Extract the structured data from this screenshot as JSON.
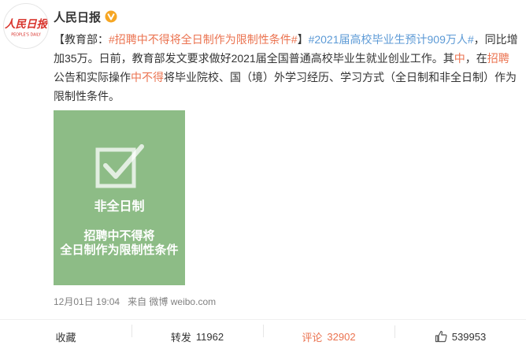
{
  "user": {
    "name": "人民日报",
    "avatar_logo_text": "人民日报",
    "avatar_sub_text": "PEOPLE'S DAILY"
  },
  "post": {
    "prefix": "【教育部：",
    "hashtag1": "#招聘中不得将全日制作为限制性条件#",
    "bracket_close": "】",
    "hashtag2": "#2021届高校毕业生预计909万人#",
    "p1": "，同比增加35万。日前，教育部发文要求做好2021届全国普通高校毕业生就业创业工作。其",
    "p1_hl": "中",
    "p2": "，在",
    "p2_hl": "招聘",
    "p3": "公告和实际操作",
    "p3_hl": "中不得",
    "p4": "将毕业院校、国（境）外学习经历、学习方式（全日制和非全日制）作为限制性条件。"
  },
  "image": {
    "tag": "非全日制",
    "line1": "招聘中不得将",
    "line2": "全日制作为限制性条件",
    "bg_color": "#8dbc86"
  },
  "meta": {
    "date": "12月01日 19:04",
    "source_label": "来自",
    "source": "微博 weibo.com"
  },
  "actions": {
    "favorite": "收藏",
    "repost_label": "转发",
    "repost_count": "11962",
    "comment_label": "评论",
    "comment_count": "32902",
    "like_count": "539953"
  },
  "colors": {
    "link_orange": "#eb7350",
    "link_blue": "#5c9ad6",
    "brand_red": "#d8322b",
    "verify_orange": "#f6a623"
  }
}
